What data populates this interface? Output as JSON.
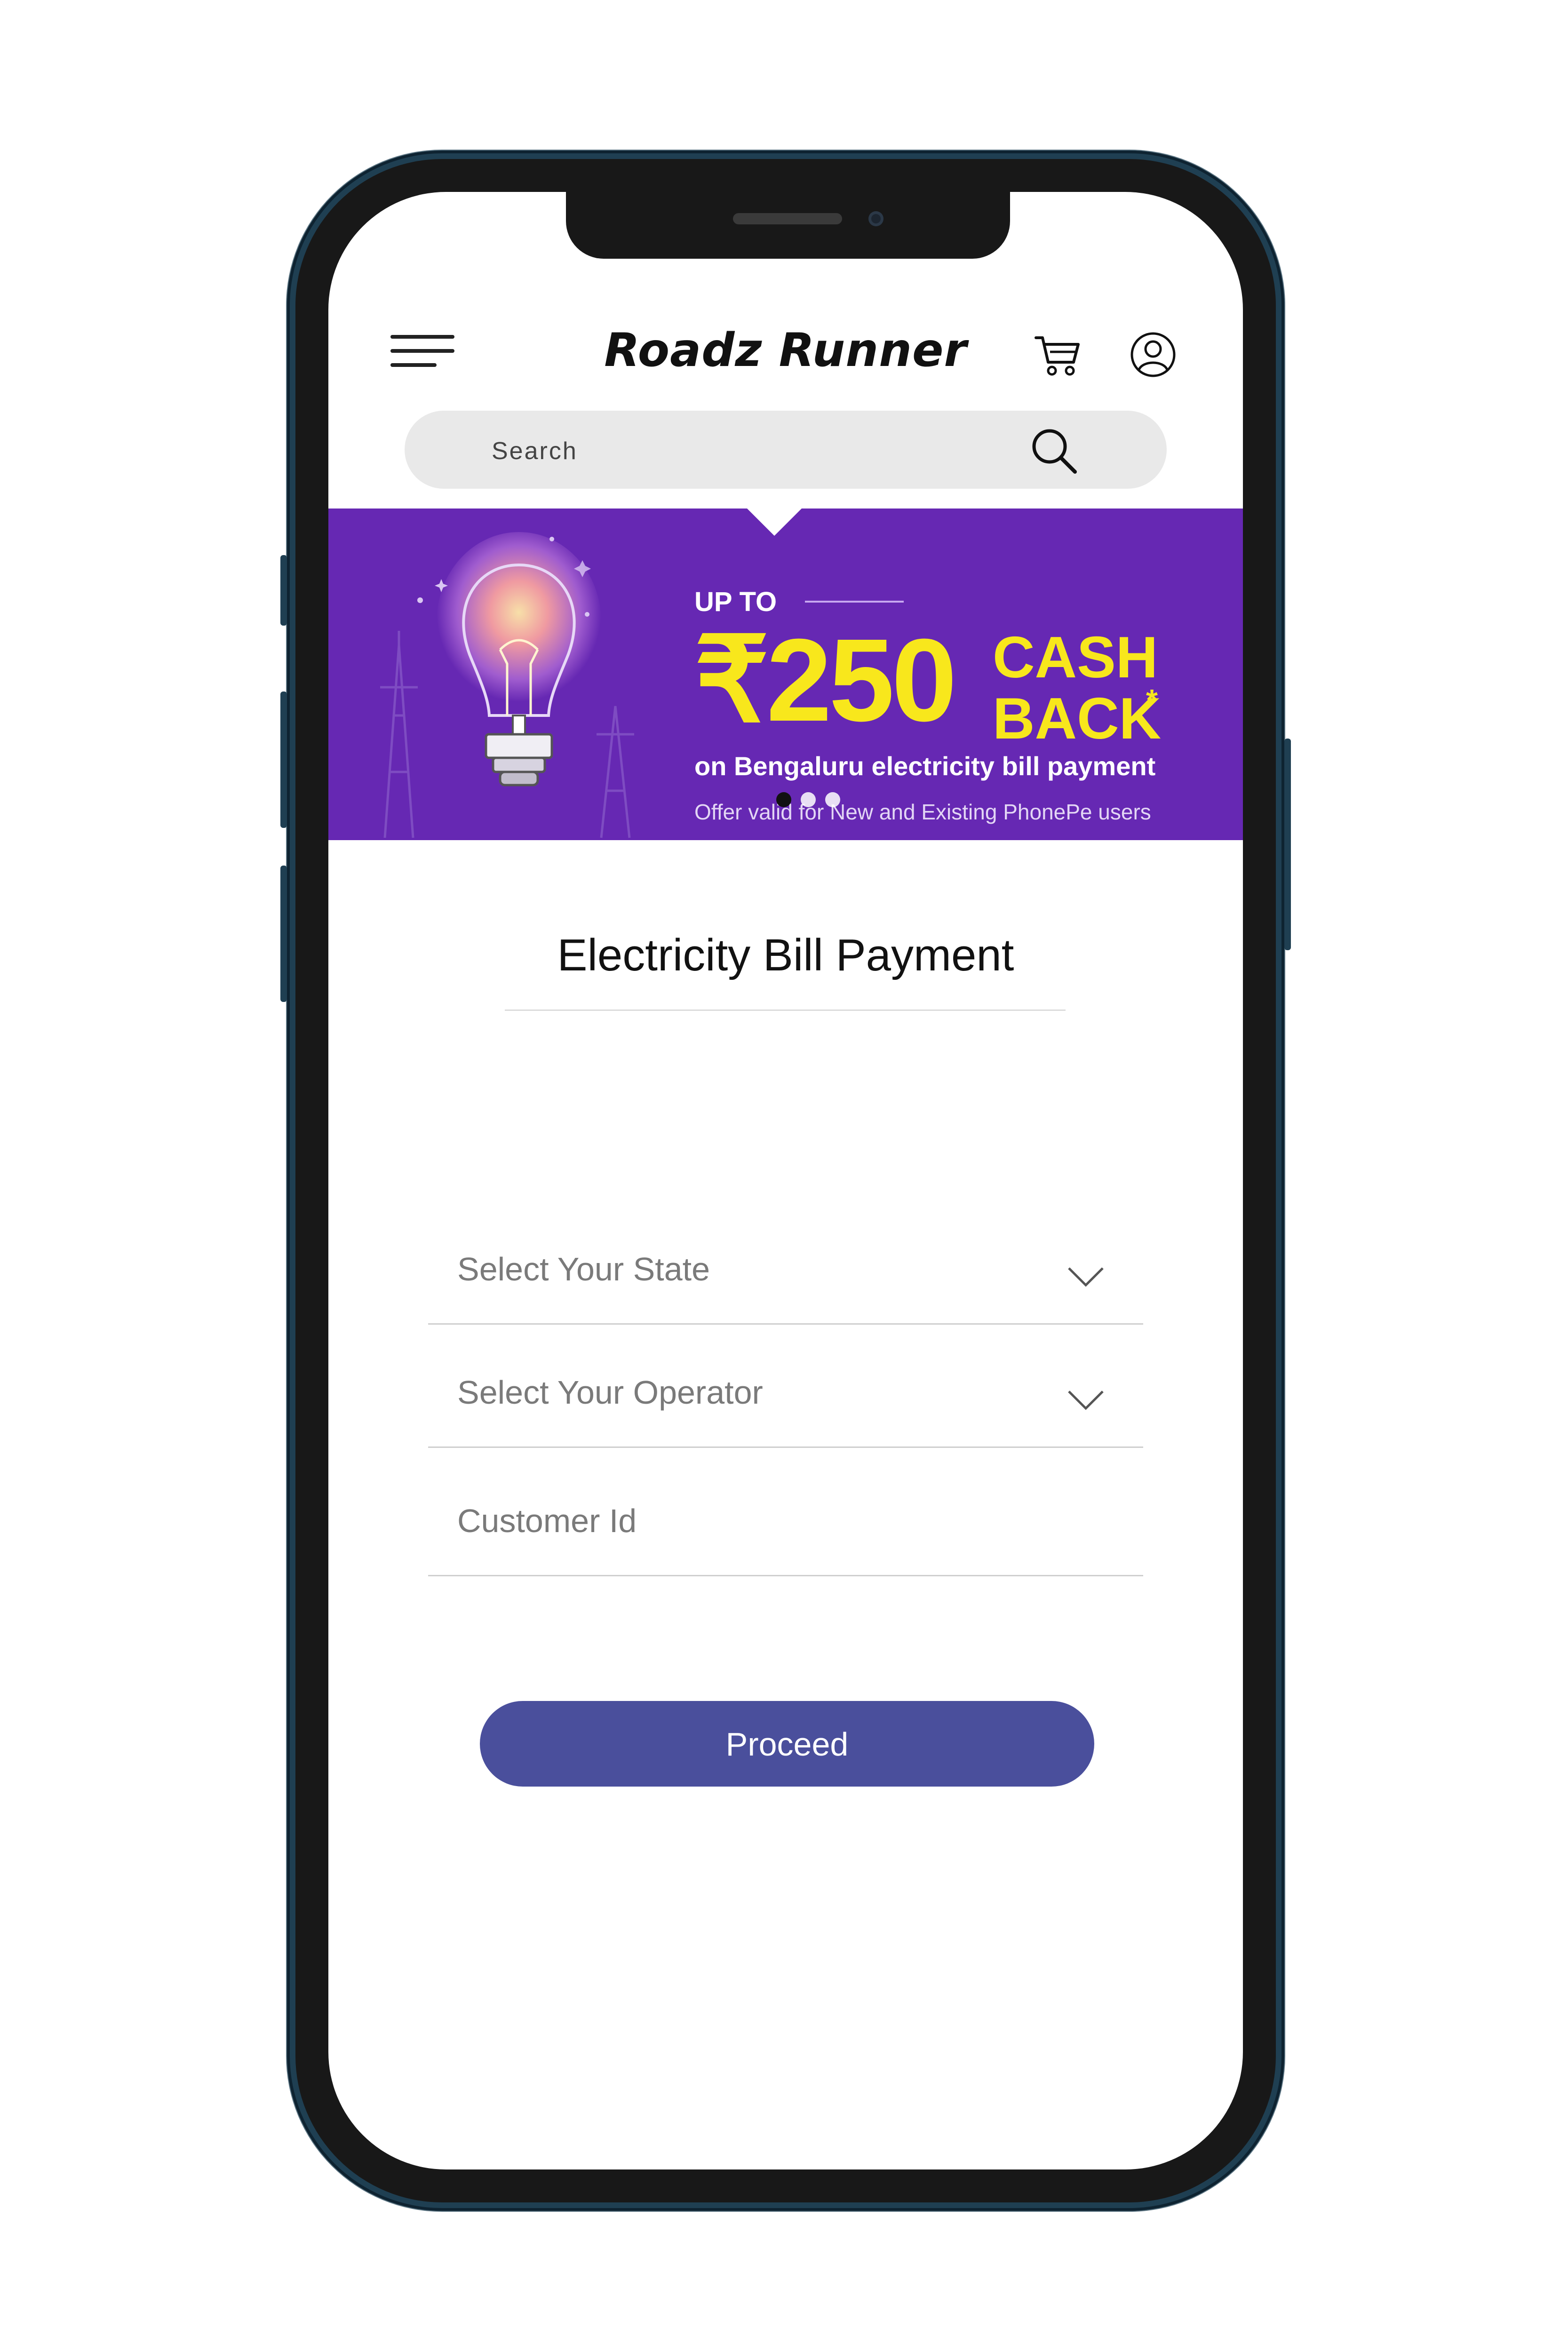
{
  "header": {
    "app_title": "Roadz Runner"
  },
  "search": {
    "placeholder": "Search"
  },
  "banner": {
    "up_to": "UP TO",
    "amount": "₹250",
    "cash": "CASH",
    "back": "BACK",
    "asterisk": "*",
    "description": "on Bengaluru electricity bill payment",
    "note": "Offer valid for New and Existing PhonePe users",
    "slide_count": 3,
    "active_slide": 1
  },
  "form": {
    "title": "Electricity Bill Payment",
    "state_select": "Select  Your State",
    "operator_select": "Select  Your Operator",
    "customer_id_placeholder": "Customer Id",
    "proceed_label": "Proceed"
  },
  "colors": {
    "banner_purple": "#6628b3",
    "promo_yellow": "#f8e71c",
    "button": "#4a4f9c",
    "phone_frame": "#1f3f52"
  }
}
